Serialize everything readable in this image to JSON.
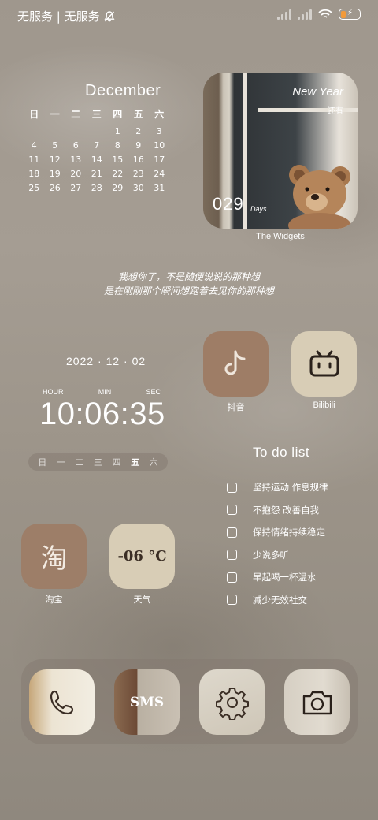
{
  "status_bar": {
    "carrier": "无服务 | 无服务",
    "icons": [
      "mute-bell-icon",
      "signal-icon",
      "signal-icon",
      "wifi-icon",
      "battery-charging-icon"
    ]
  },
  "calendar": {
    "month": "December",
    "weekdays": [
      "日",
      "一",
      "二",
      "三",
      "四",
      "五",
      "六"
    ],
    "weeks": [
      [
        "",
        "",
        "",
        "",
        "1",
        "2",
        "3"
      ],
      [
        "4",
        "5",
        "6",
        "7",
        "8",
        "9",
        "10"
      ],
      [
        "11",
        "12",
        "13",
        "14",
        "15",
        "16",
        "17"
      ],
      [
        "18",
        "19",
        "20",
        "21",
        "22",
        "23",
        "24"
      ],
      [
        "25",
        "26",
        "27",
        "28",
        "29",
        "30",
        "31"
      ]
    ]
  },
  "countdown_widget": {
    "event": "New Year",
    "still_label": "还有",
    "count": "029",
    "unit": "Days",
    "label": "The Widgets"
  },
  "quote": {
    "line1": "我想你了，不是随便说说的那种想",
    "line2": "是在刚刚那个瞬间想跑着去见你的那种想"
  },
  "clock": {
    "date": "2022 · 12 · 02",
    "hour_label": "HOUR",
    "min_label": "MIN",
    "sec_label": "SEC",
    "time": "10:06:35",
    "weekdays": [
      "日",
      "一",
      "二",
      "三",
      "四",
      "五",
      "六"
    ],
    "active_weekday": "五"
  },
  "apps": {
    "douyin": {
      "label": "抖音",
      "icon": "tiktok-note-icon"
    },
    "bilibili": {
      "label": "Bilibili",
      "icon": "bilibili-tv-icon"
    },
    "taobao": {
      "label": "淘宝",
      "glyph": "淘"
    },
    "weather": {
      "label": "天气",
      "temp": "-06 °C"
    }
  },
  "todo": {
    "title": "To do list",
    "items": [
      "坚持运动 作息规律",
      "不抱怨 改善自我",
      "保持情绪持续稳定",
      "少说多听",
      "早起喝一杯温水",
      "减少无效社交"
    ]
  },
  "dock": {
    "phone_icon": "phone-icon",
    "sms_text": "SMS",
    "settings_icon": "gear-icon",
    "camera_icon": "camera-icon"
  }
}
